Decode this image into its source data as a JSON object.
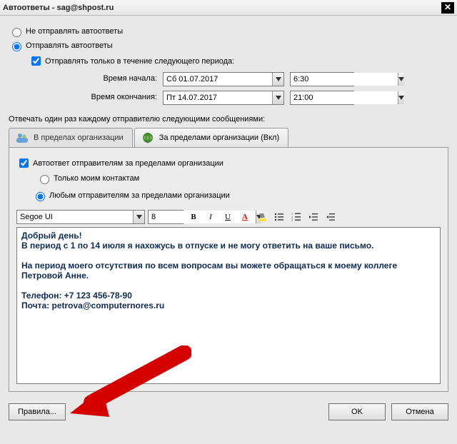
{
  "window": {
    "title": "Автоответы - sag@shpost.ru"
  },
  "radios": {
    "doNotSend": "Не отправлять автоответы",
    "send": "Отправлять автоответы"
  },
  "period": {
    "checkbox": "Отправлять только в течение следующего периода:",
    "startLabel": "Время начала:",
    "startDate": "Сб 01.07.2017",
    "startTime": "6:30",
    "endLabel": "Время окончания:",
    "endDate": "Пт 14.07.2017",
    "endTime": "21:00"
  },
  "replySection": "Отвечать один раз каждому отправителю следующими сообщениями:",
  "tabs": {
    "inside": "В пределах организации",
    "outside": "За пределами организации (Вкл)"
  },
  "outsidePanel": {
    "enable": "Автоответ отправителям за пределами организации",
    "onlyContacts": "Только моим контактам",
    "anySender": "Любым отправителям за пределами организации"
  },
  "format": {
    "fontName": "Segoe UI",
    "fontSize": "8"
  },
  "messageBody": "Добрый день!\nВ период с 1 по 14 июля я нахожусь в отпуске и не могу ответить на ваше письмо.\n\nНа период моего отсутствия по всем вопросам вы можете обращаться к моему коллеге Петровой Анне.\n\nТелефон: +7 123 456-78-90\nПочта: petrova@computernores.ru",
  "buttons": {
    "rules": "Правила...",
    "ok": "OK",
    "cancel": "Отмена"
  }
}
